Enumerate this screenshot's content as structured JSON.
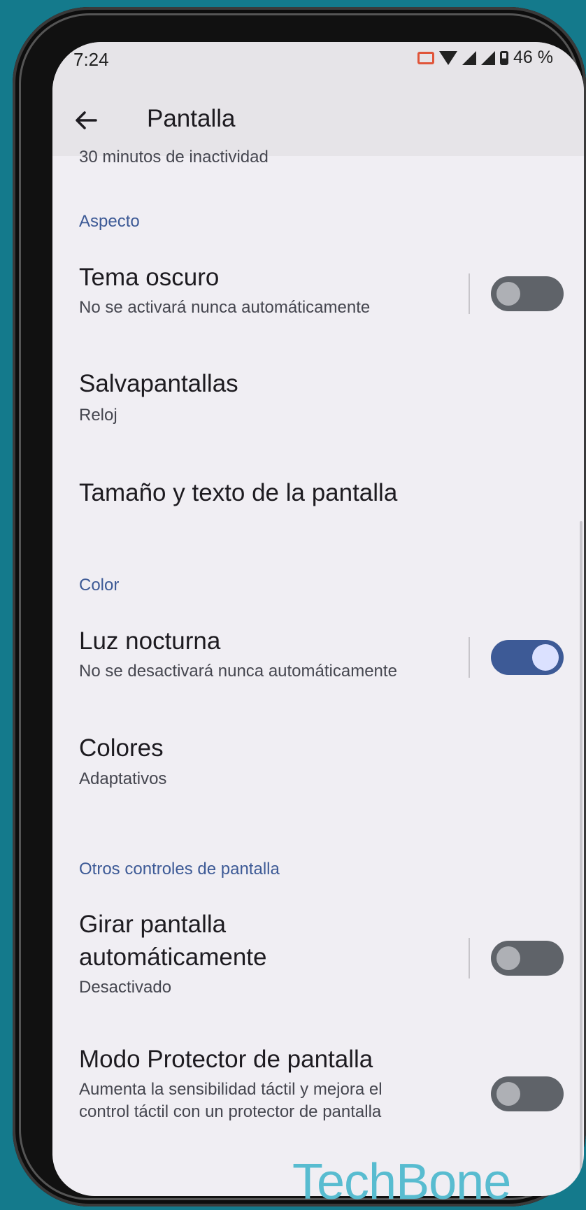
{
  "status_bar": {
    "time": "7:24",
    "battery": "46 %"
  },
  "app_bar": {
    "title": "Pantalla"
  },
  "clipped_subtitle": "30 minutos de inactividad",
  "sections": {
    "aspecto": "Aspecto",
    "color": "Color",
    "otros": "Otros controles de pantalla"
  },
  "items": {
    "tema_oscuro": {
      "title": "Tema oscuro",
      "subtitle": "No se activará nunca automáticamente",
      "toggle": false
    },
    "salvapantallas": {
      "title": "Salvapantallas",
      "subtitle": "Reloj"
    },
    "tamano": {
      "title": "Tamaño y texto de la pantalla"
    },
    "luz_nocturna": {
      "title": "Luz nocturna",
      "subtitle": "No se desactivará nunca automáticamente",
      "toggle": true
    },
    "colores": {
      "title": "Colores",
      "subtitle": "Adaptativos"
    },
    "girar": {
      "title_line1": "Girar pantalla",
      "title_line2": "automáticamente",
      "subtitle": "Desactivado",
      "toggle": false
    },
    "protector": {
      "title": "Modo Protector de pantalla",
      "subtitle_line1": "Aumenta la sensibilidad táctil y mejora el",
      "subtitle_line2": "control táctil con un protector de pantalla",
      "toggle": false
    }
  },
  "watermark": "TechBone",
  "colors": {
    "accent": "#3d5a96",
    "background": "#f0eef3",
    "frame": "#147a8c"
  }
}
